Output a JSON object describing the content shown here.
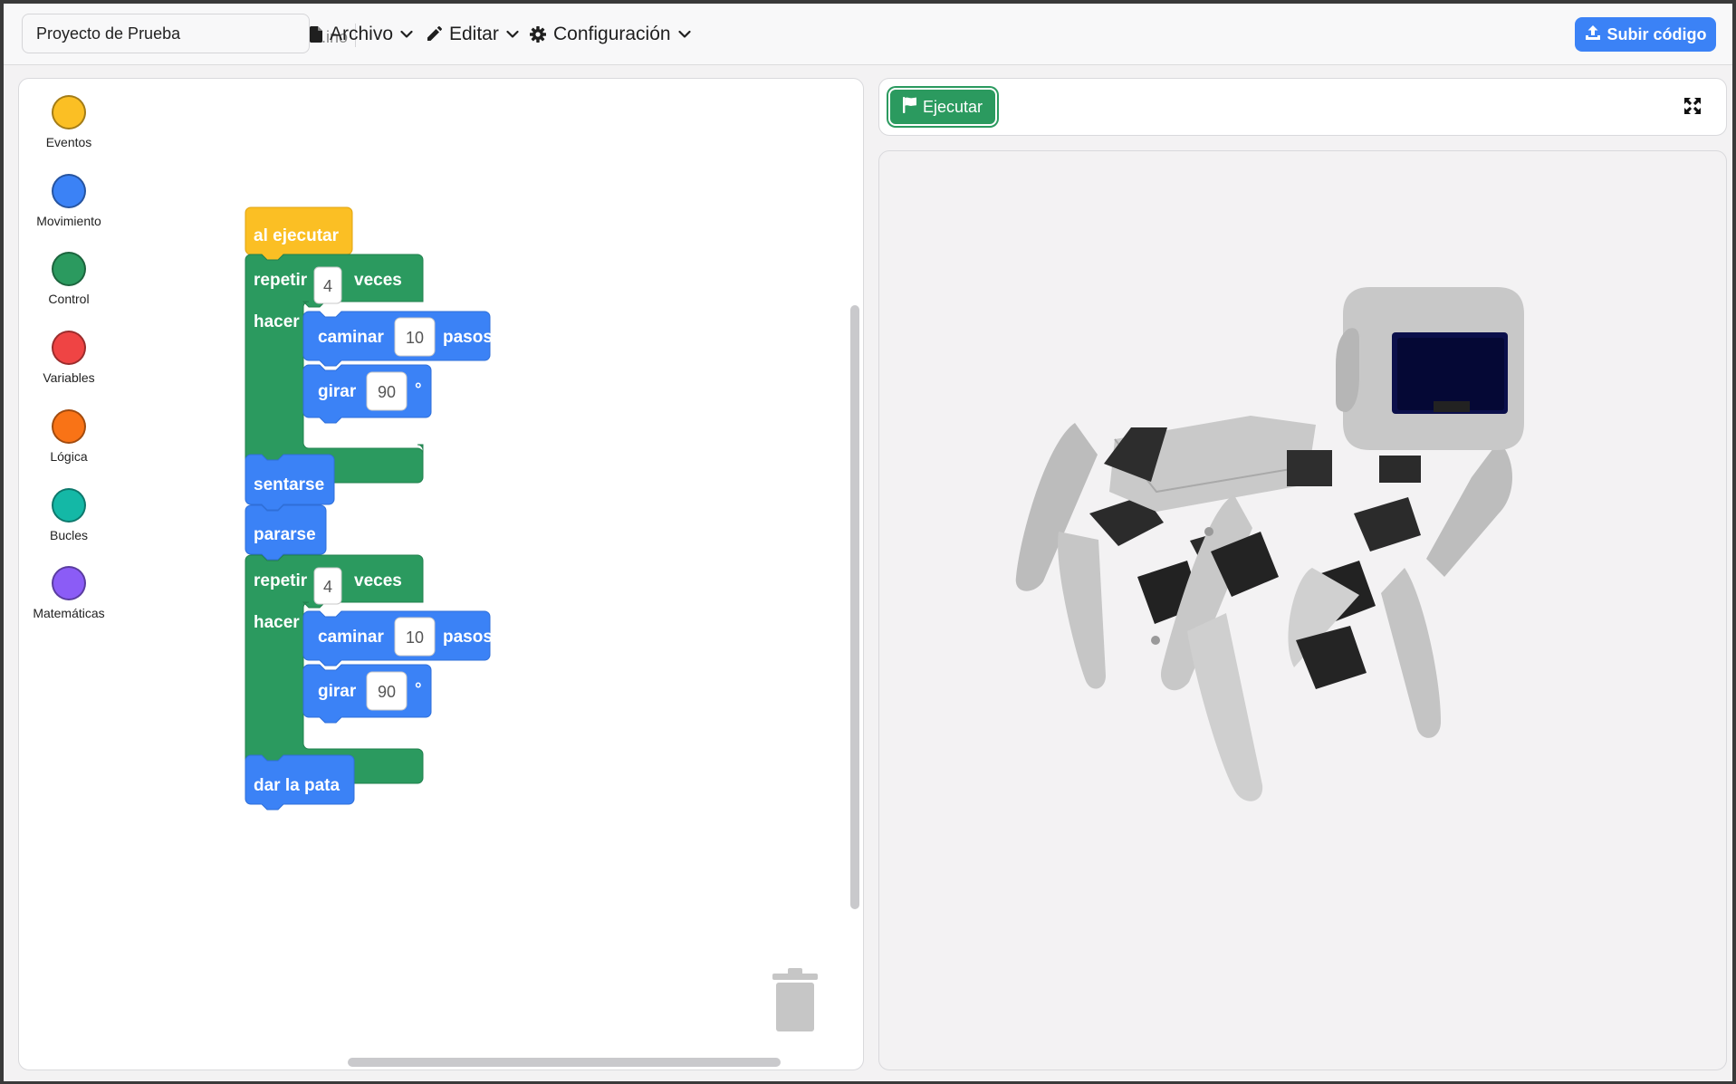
{
  "header": {
    "project_name": "Proyecto de Prueba",
    "extension": ".ino",
    "menus": [
      {
        "label": "Archivo",
        "icon": "file-icon"
      },
      {
        "label": "Editar",
        "icon": "pencil-icon"
      },
      {
        "label": "Configuración",
        "icon": "gear-icon"
      }
    ],
    "upload_label": "Subir código",
    "upload_icon": "upload-icon"
  },
  "toolbox": {
    "categories": [
      {
        "label": "Eventos",
        "color": "#fbbf24"
      },
      {
        "label": "Movimiento",
        "color": "#3b82f6"
      },
      {
        "label": "Control",
        "color": "#2b9a5f"
      },
      {
        "label": "Variables",
        "color": "#ef4444"
      },
      {
        "label": "Lógica",
        "color": "#f97316"
      },
      {
        "label": "Bucles",
        "color": "#14b8a6"
      },
      {
        "label": "Matemáticas",
        "color": "#8b5cf6"
      }
    ]
  },
  "program": {
    "event_block": "al ejecutar",
    "loop1": {
      "repeat": "repetir",
      "count": "4",
      "times": "veces",
      "do": "hacer",
      "walk": {
        "label": "caminar",
        "value": "10",
        "unit": "pasos"
      },
      "turn": {
        "label": "girar",
        "value": "90",
        "unit": "°"
      }
    },
    "sit": "sentarse",
    "stand": "pararse",
    "loop2": {
      "repeat": "repetir",
      "count": "4",
      "times": "veces",
      "do": "hacer",
      "walk": {
        "label": "caminar",
        "value": "10",
        "unit": "pasos"
      },
      "turn": {
        "label": "girar",
        "value": "90",
        "unit": "°"
      }
    },
    "paw": "dar la pata"
  },
  "runner": {
    "run_label": "Ejecutar",
    "run_icon": "flag-icon",
    "fullscreen_icon": "expand-icon"
  },
  "colors": {
    "event": "#fbbf24",
    "control": "#2b9a5f",
    "motion": "#3b82f6",
    "accent": "#3b82f6"
  }
}
